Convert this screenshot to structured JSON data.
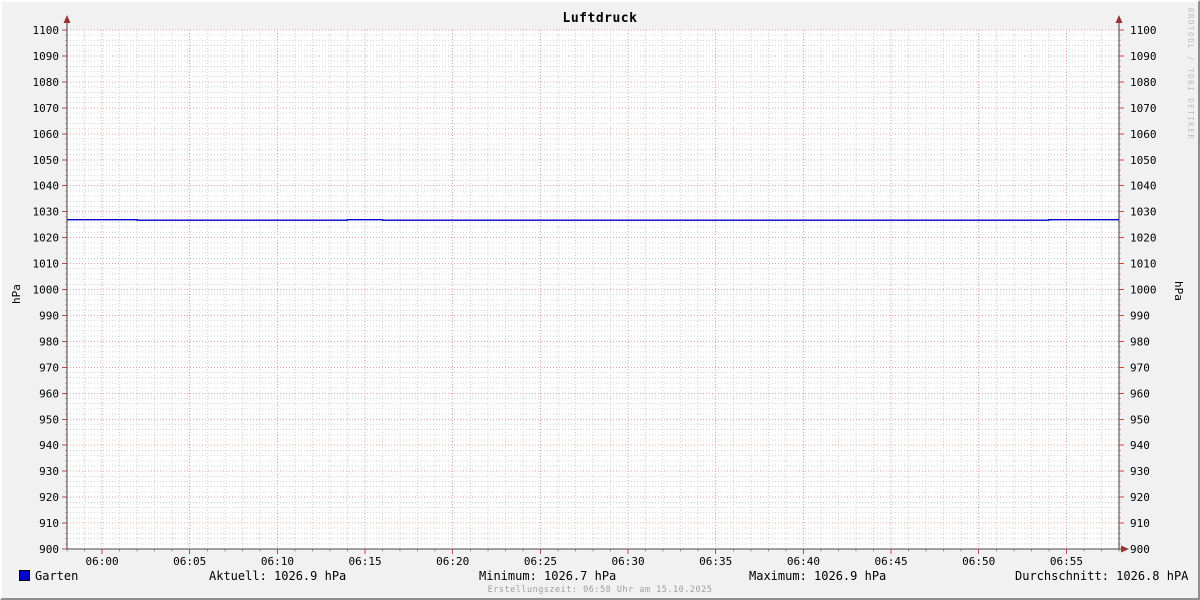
{
  "title": "Luftdruck",
  "watermark": "RRDTOOL / TOBI OETIKER",
  "footer": {
    "creation_time": "Erstellungszeit: 06:58 Uhr am 15.10.2025"
  },
  "legend": {
    "series_label": "Garten",
    "swatch_color": "#0000cc",
    "stats": [
      {
        "id": "current",
        "text": "Aktuell: 1026.9 hPa"
      },
      {
        "id": "min",
        "text": "Minimum: 1026.7 hPa"
      },
      {
        "id": "max",
        "text": "Maximum: 1026.9 hPa"
      },
      {
        "id": "avg",
        "text": "Durchschnitt: 1026.8 hPA"
      }
    ]
  },
  "colors": {
    "background": "#f1f1f1",
    "canvas": "#ffffff",
    "grid_major": "#e8a0a0",
    "grid_minor": "#d4d4d4",
    "axis": "#444444",
    "arrow": "#993333",
    "tick_major": "#cc4444",
    "tick_minor": "#999999",
    "line": "#0000cc",
    "text": "#000000"
  },
  "chart_data": {
    "type": "line",
    "title": "Luftdruck",
    "ylabel_left": "hPa",
    "ylabel_right": "hPa",
    "ylim": [
      900,
      1100
    ],
    "y_major_step": 10,
    "y_minor_step": 2,
    "x_start": "05:58",
    "x_end": "06:58",
    "x_major_step_min": 5,
    "x_minor_step_min": 1,
    "x_tick_labels": [
      "06:00",
      "06:05",
      "06:10",
      "06:15",
      "06:20",
      "06:25",
      "06:30",
      "06:35",
      "06:40",
      "06:45",
      "06:50",
      "06:55"
    ],
    "grid": true,
    "legend_position": "bottom",
    "series": [
      {
        "name": "Garten",
        "color": "#0000cc",
        "unit": "hPa",
        "points": [
          [
            "05:58",
            1026.9
          ],
          [
            "06:02",
            1026.9
          ],
          [
            "06:02",
            1026.7
          ],
          [
            "06:14",
            1026.7
          ],
          [
            "06:14",
            1026.9
          ],
          [
            "06:16",
            1026.9
          ],
          [
            "06:16",
            1026.7
          ],
          [
            "06:54",
            1026.7
          ],
          [
            "06:54",
            1026.9
          ],
          [
            "06:58",
            1026.9
          ]
        ]
      }
    ],
    "stats": {
      "current_hPa": 1026.9,
      "min_hPa": 1026.7,
      "max_hPa": 1026.9,
      "avg_hPa": 1026.8
    }
  }
}
